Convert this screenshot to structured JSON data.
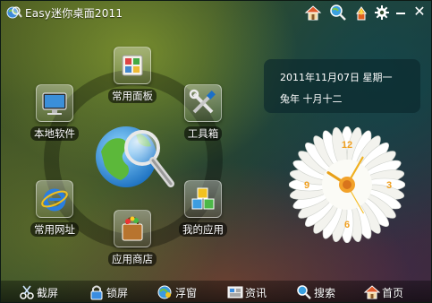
{
  "window": {
    "title": "Easy迷你桌面2011",
    "title_icon": "globe-magnifier-icon",
    "toolbar_icons": [
      "home-icon",
      "search-icon",
      "fire-icon",
      "gear-icon"
    ]
  },
  "launcher": {
    "items": [
      {
        "label": "常用面板",
        "icon": "panel-icon"
      },
      {
        "label": "本地软件",
        "icon": "monitor-icon"
      },
      {
        "label": "工具箱",
        "icon": "tools-icon"
      },
      {
        "label": "常用网址",
        "icon": "ie-icon"
      },
      {
        "label": "我的应用",
        "icon": "cubes-icon"
      },
      {
        "label": "应用商店",
        "icon": "shopping-bag-icon"
      }
    ],
    "center_icon": "globe-search-icon"
  },
  "date": {
    "gregorian": "2011年11月07日 星期一",
    "lunar": "兔年  十月十二"
  },
  "clock": {
    "numerals": [
      "12",
      "3",
      "6",
      "9"
    ],
    "hour": 10,
    "minute": 5,
    "second": 25
  },
  "bottom_bar": {
    "items": [
      {
        "label": "截屏",
        "icon": "scissors-icon"
      },
      {
        "label": "锁屏",
        "icon": "lock-icon"
      },
      {
        "label": "浮窗",
        "icon": "float-window-icon"
      },
      {
        "label": "资讯",
        "icon": "news-icon"
      },
      {
        "label": "搜索",
        "icon": "search-icon"
      },
      {
        "label": "首页",
        "icon": "home-icon"
      }
    ]
  },
  "colors": {
    "accent": "#f5b81c",
    "date_panel": "#0a282d"
  }
}
